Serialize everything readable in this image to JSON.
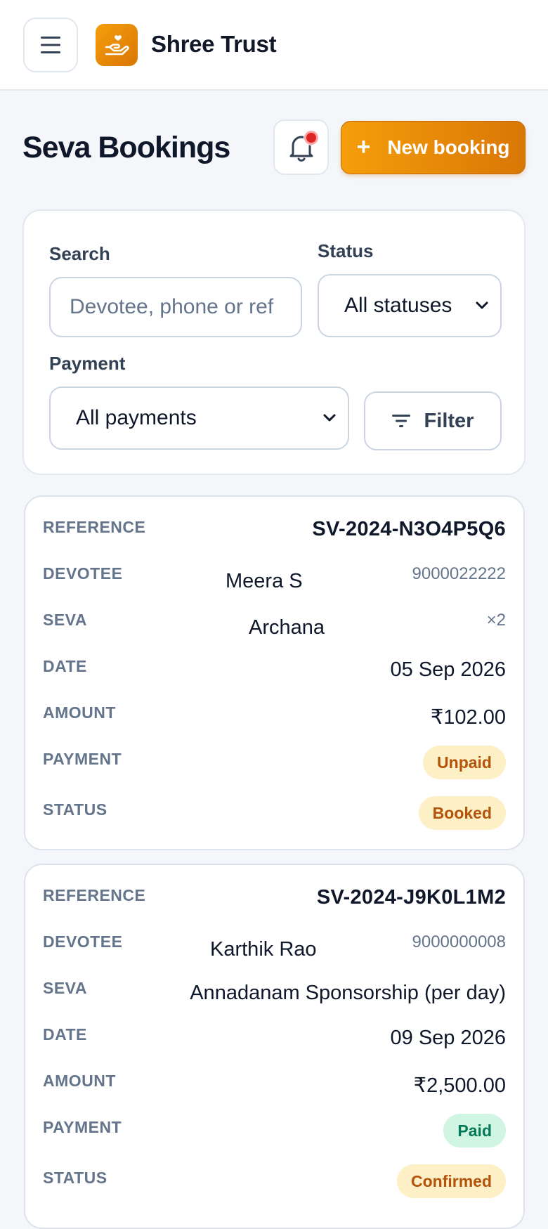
{
  "app": {
    "brand": "Shree Trust",
    "icons": {
      "menu": "menu-icon",
      "logo": "hand-heart-icon",
      "bell": "bell-icon",
      "filter": "filter-lines-icon"
    }
  },
  "header": {
    "title": "Seva Bookings",
    "new_booking_label": "New booking",
    "new_booking_plus": "+"
  },
  "filters": {
    "search_label": "Search",
    "search_placeholder": "Devotee, phone or ref",
    "status_label": "Status",
    "status_value": "All statuses",
    "payment_label": "Payment",
    "payment_value": "All payments",
    "filter_button": "Filter"
  },
  "field_labels": {
    "reference": "REFERENCE",
    "devotee": "DEVOTEE",
    "seva": "SEVA",
    "date": "DATE",
    "amount": "AMOUNT",
    "payment": "PAYMENT",
    "status": "STATUS"
  },
  "bookings": [
    {
      "reference": "SV-2024-N3O4P5Q6",
      "devotee": "Meera S",
      "phone": "9000022222",
      "seva": "Archana",
      "quantity": "×2",
      "date": "05 Sep 2026",
      "amount": "₹102.00",
      "payment": "Unpaid",
      "status": "Booked"
    },
    {
      "reference": "SV-2024-J9K0L1M2",
      "devotee": "Karthik Rao",
      "phone": "9000000008",
      "seva": "Annadanam Sponsorship (per day)",
      "date": "09 Sep 2026",
      "amount": "₹2,500.00",
      "payment": "Paid",
      "status": "Confirmed"
    }
  ],
  "colors": {
    "accent": "#f59e0b",
    "accent_dark": "#d97706",
    "badge_warn_bg": "#fdf0c6",
    "badge_warn_text": "#b45309",
    "badge_ok_bg": "#d1f5e3",
    "badge_ok_text": "#047857",
    "notification_dot": "#dc2626"
  }
}
